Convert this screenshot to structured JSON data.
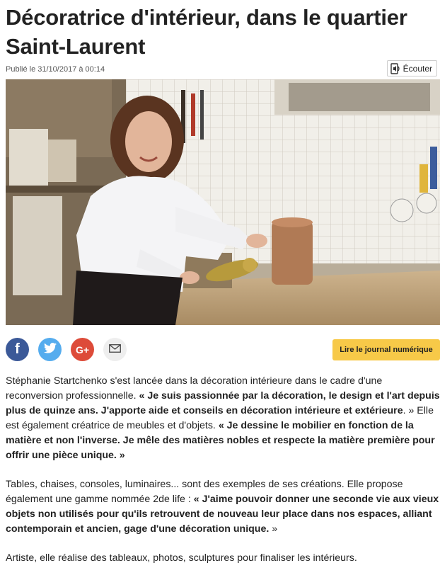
{
  "article": {
    "title": "Décoratrice d'intérieur, dans le quartier Saint-Laurent",
    "published": "Publié le 31/10/2017 à 00:14",
    "listen_label": "Écouter",
    "cta_label": "Lire le journal numérique",
    "social": [
      {
        "name": "facebook",
        "color": "#3b5998",
        "glyph": "f"
      },
      {
        "name": "twitter",
        "color": "#55acee",
        "glyph": "t"
      },
      {
        "name": "google-plus",
        "color": "#dd4b39",
        "glyph": "G+"
      },
      {
        "name": "email",
        "color": "#eeeeee",
        "glyph": "envelope"
      }
    ],
    "p1": {
      "t1": "Stéphanie Startchenko s'est lancée dans la décoration intérieure dans le cadre d'une reconversion professionnelle. ",
      "q1": "« Je suis passionnée par la décoration, le design et l'art depuis plus de quinze ans. J'apporte aide et conseils en décoration intérieure et extérieure",
      "t2": ". » Elle est également créatrice de meubles et d'objets. ",
      "q2": "« Je dessine le mobilier en fonction de la matière et non l'inverse. Je mêle des matières nobles et respecte la matière première pour offrir une pièce unique. »"
    },
    "p2": {
      "t1": "Tables, chaises, consoles, luminaires... sont des exemples de ses créations. Elle propose également une gamme nommée 2de life : ",
      "q1": "« J'aime pouvoir donner une seconde vie aux vieux objets non utilisés pour qu'ils retrouvent de nouveau leur place dans nos espaces, alliant contemporain et ancien, gage d'une décoration unique.",
      "t2": " »"
    },
    "p3": "Artiste, elle réalise des tableaux, photos, sculptures pour finaliser les intérieurs."
  }
}
